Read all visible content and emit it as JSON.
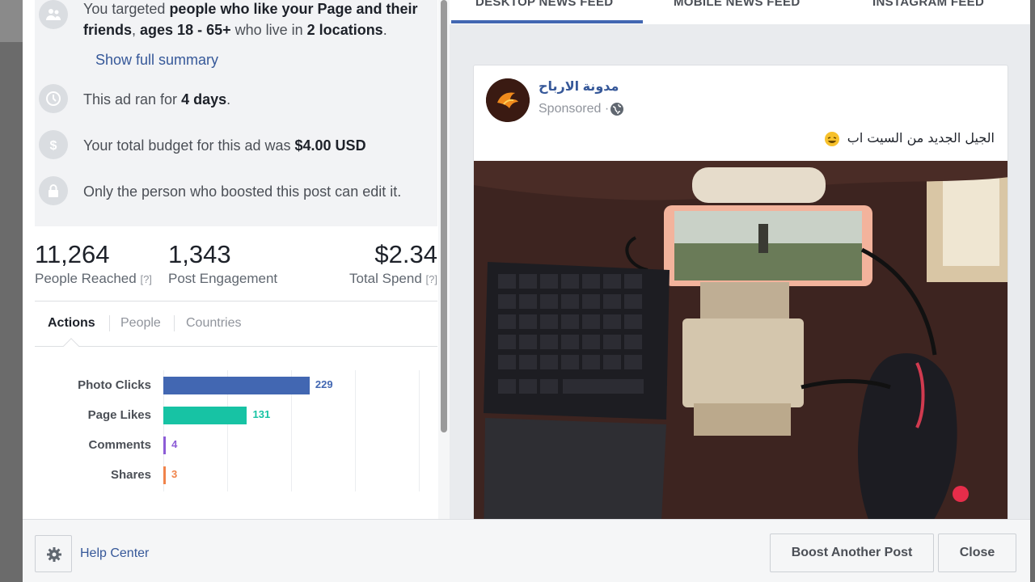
{
  "summary": {
    "audience": {
      "prefix": "You targeted ",
      "bold1": "people who like your Page and their friends",
      "mid1": ", ",
      "bold2": "ages 18 - 65+",
      "mid2": " who live in ",
      "bold3": "2 locations",
      "suffix": "."
    },
    "show_full": "Show full summary",
    "duration": {
      "prefix": "This ad ran for ",
      "bold": "4 days",
      "suffix": "."
    },
    "budget": {
      "prefix": "Your total budget for this ad was ",
      "bold": "$4.00 USD"
    },
    "edit_note": "Only the person who boosted this post can edit it."
  },
  "stats": [
    {
      "value": "11,264",
      "label": "People Reached",
      "help": "[?]"
    },
    {
      "value": "1,343",
      "label": "Post Engagement"
    },
    {
      "value": "$2.34",
      "label": "Total Spend",
      "help": "[?]"
    }
  ],
  "tabs": [
    "Actions",
    "People",
    "Countries"
  ],
  "chart_data": {
    "type": "bar",
    "orientation": "horizontal",
    "categories": [
      "Photo Clicks",
      "Page Likes",
      "Comments",
      "Shares"
    ],
    "values": [
      229,
      131,
      4,
      3
    ],
    "colors": [
      "#4267b2",
      "#17c3a4",
      "#8c5cd6",
      "#f0834a"
    ],
    "xlim": [
      0,
      400
    ],
    "grid": true
  },
  "feed_tabs": [
    "DESKTOP NEWS FEED",
    "MOBILE NEWS FEED",
    "INSTAGRAM FEED"
  ],
  "post": {
    "page_name": "مدونة الارباح",
    "sponsored": "Sponsored ·",
    "text": "الجيل الجديد من السيت اب"
  },
  "footer": {
    "help": "Help Center",
    "boost": "Boost Another Post",
    "close": "Close"
  },
  "colors": {
    "link": "#365899",
    "accent": "#4267b2"
  }
}
